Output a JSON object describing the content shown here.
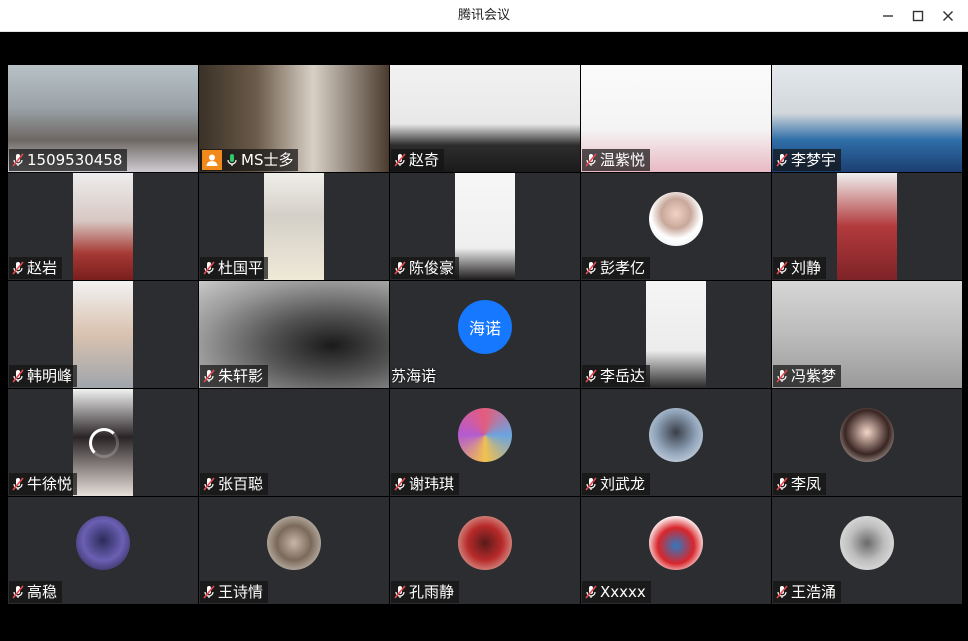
{
  "window": {
    "title": "腾讯会议",
    "controls": {
      "minimize_icon": "minimize-icon",
      "maximize_icon": "maximize-icon",
      "close_icon": "close-icon"
    }
  },
  "colors": {
    "stage_bg": "#000000",
    "tile_bg": "#2b2d30",
    "active_speaker_border": "#35c26a",
    "host_badge": "#f28a1b",
    "muted_mic": "#e8484d",
    "unmuted_mic": "#2fc86a",
    "avatar_blue": "#1677ff"
  },
  "participants": [
    {
      "name": "1509530458",
      "mic": "muted"
    },
    {
      "name": "MS士多",
      "mic": "unmuted",
      "host": true,
      "active": true
    },
    {
      "name": "赵奇",
      "mic": "muted"
    },
    {
      "name": "温紫悦",
      "mic": "muted"
    },
    {
      "name": "李梦宇",
      "mic": "muted"
    },
    {
      "name": "赵岩",
      "mic": "muted"
    },
    {
      "name": "杜国平",
      "mic": "muted"
    },
    {
      "name": "陈俊豪",
      "mic": "muted"
    },
    {
      "name": "彭孝亿",
      "mic": "muted"
    },
    {
      "name": "刘静",
      "mic": "muted"
    },
    {
      "name": "韩明峰",
      "mic": "muted"
    },
    {
      "name": "朱轩影",
      "mic": "muted"
    },
    {
      "name": "苏海诺",
      "mic": "none",
      "avatar_text": "海诺"
    },
    {
      "name": "李岳达",
      "mic": "muted"
    },
    {
      "name": "冯紫梦",
      "mic": "muted"
    },
    {
      "name": "牛徐悦",
      "mic": "muted"
    },
    {
      "name": "张百聪",
      "mic": "muted"
    },
    {
      "name": "谢玮琪",
      "mic": "muted"
    },
    {
      "name": "刘武龙",
      "mic": "muted"
    },
    {
      "name": "李凤",
      "mic": "muted"
    },
    {
      "name": "高稳",
      "mic": "muted"
    },
    {
      "name": "王诗情",
      "mic": "muted"
    },
    {
      "name": "孔雨静",
      "mic": "muted"
    },
    {
      "name": "Xxxxx",
      "mic": "muted"
    },
    {
      "name": "王浩涌",
      "mic": "muted"
    }
  ]
}
